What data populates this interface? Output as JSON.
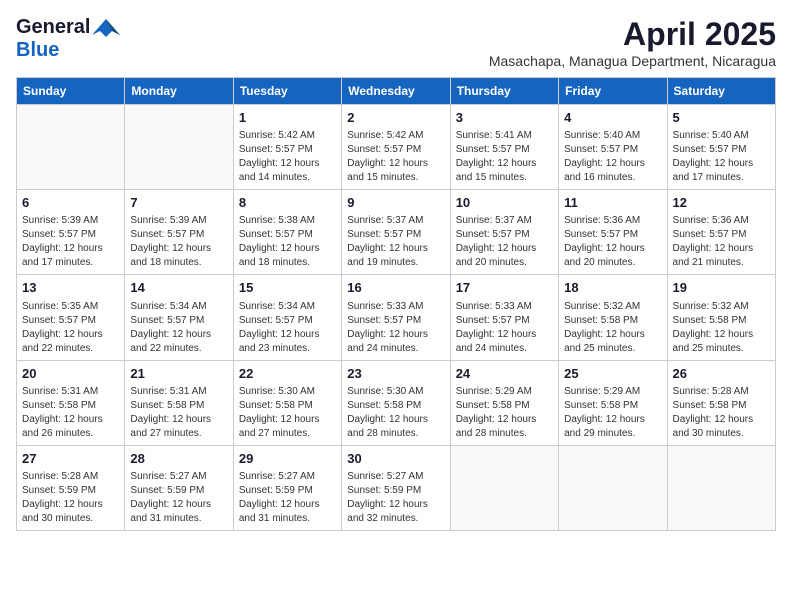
{
  "logo": {
    "general": "General",
    "blue": "Blue"
  },
  "title": "April 2025",
  "location": "Masachapa, Managua Department, Nicaragua",
  "days_header": [
    "Sunday",
    "Monday",
    "Tuesday",
    "Wednesday",
    "Thursday",
    "Friday",
    "Saturday"
  ],
  "weeks": [
    [
      {
        "day": "",
        "info": ""
      },
      {
        "day": "",
        "info": ""
      },
      {
        "day": "1",
        "info": "Sunrise: 5:42 AM\nSunset: 5:57 PM\nDaylight: 12 hours\nand 14 minutes."
      },
      {
        "day": "2",
        "info": "Sunrise: 5:42 AM\nSunset: 5:57 PM\nDaylight: 12 hours\nand 15 minutes."
      },
      {
        "day": "3",
        "info": "Sunrise: 5:41 AM\nSunset: 5:57 PM\nDaylight: 12 hours\nand 15 minutes."
      },
      {
        "day": "4",
        "info": "Sunrise: 5:40 AM\nSunset: 5:57 PM\nDaylight: 12 hours\nand 16 minutes."
      },
      {
        "day": "5",
        "info": "Sunrise: 5:40 AM\nSunset: 5:57 PM\nDaylight: 12 hours\nand 17 minutes."
      }
    ],
    [
      {
        "day": "6",
        "info": "Sunrise: 5:39 AM\nSunset: 5:57 PM\nDaylight: 12 hours\nand 17 minutes."
      },
      {
        "day": "7",
        "info": "Sunrise: 5:39 AM\nSunset: 5:57 PM\nDaylight: 12 hours\nand 18 minutes."
      },
      {
        "day": "8",
        "info": "Sunrise: 5:38 AM\nSunset: 5:57 PM\nDaylight: 12 hours\nand 18 minutes."
      },
      {
        "day": "9",
        "info": "Sunrise: 5:37 AM\nSunset: 5:57 PM\nDaylight: 12 hours\nand 19 minutes."
      },
      {
        "day": "10",
        "info": "Sunrise: 5:37 AM\nSunset: 5:57 PM\nDaylight: 12 hours\nand 20 minutes."
      },
      {
        "day": "11",
        "info": "Sunrise: 5:36 AM\nSunset: 5:57 PM\nDaylight: 12 hours\nand 20 minutes."
      },
      {
        "day": "12",
        "info": "Sunrise: 5:36 AM\nSunset: 5:57 PM\nDaylight: 12 hours\nand 21 minutes."
      }
    ],
    [
      {
        "day": "13",
        "info": "Sunrise: 5:35 AM\nSunset: 5:57 PM\nDaylight: 12 hours\nand 22 minutes."
      },
      {
        "day": "14",
        "info": "Sunrise: 5:34 AM\nSunset: 5:57 PM\nDaylight: 12 hours\nand 22 minutes."
      },
      {
        "day": "15",
        "info": "Sunrise: 5:34 AM\nSunset: 5:57 PM\nDaylight: 12 hours\nand 23 minutes."
      },
      {
        "day": "16",
        "info": "Sunrise: 5:33 AM\nSunset: 5:57 PM\nDaylight: 12 hours\nand 24 minutes."
      },
      {
        "day": "17",
        "info": "Sunrise: 5:33 AM\nSunset: 5:57 PM\nDaylight: 12 hours\nand 24 minutes."
      },
      {
        "day": "18",
        "info": "Sunrise: 5:32 AM\nSunset: 5:58 PM\nDaylight: 12 hours\nand 25 minutes."
      },
      {
        "day": "19",
        "info": "Sunrise: 5:32 AM\nSunset: 5:58 PM\nDaylight: 12 hours\nand 25 minutes."
      }
    ],
    [
      {
        "day": "20",
        "info": "Sunrise: 5:31 AM\nSunset: 5:58 PM\nDaylight: 12 hours\nand 26 minutes."
      },
      {
        "day": "21",
        "info": "Sunrise: 5:31 AM\nSunset: 5:58 PM\nDaylight: 12 hours\nand 27 minutes."
      },
      {
        "day": "22",
        "info": "Sunrise: 5:30 AM\nSunset: 5:58 PM\nDaylight: 12 hours\nand 27 minutes."
      },
      {
        "day": "23",
        "info": "Sunrise: 5:30 AM\nSunset: 5:58 PM\nDaylight: 12 hours\nand 28 minutes."
      },
      {
        "day": "24",
        "info": "Sunrise: 5:29 AM\nSunset: 5:58 PM\nDaylight: 12 hours\nand 28 minutes."
      },
      {
        "day": "25",
        "info": "Sunrise: 5:29 AM\nSunset: 5:58 PM\nDaylight: 12 hours\nand 29 minutes."
      },
      {
        "day": "26",
        "info": "Sunrise: 5:28 AM\nSunset: 5:58 PM\nDaylight: 12 hours\nand 30 minutes."
      }
    ],
    [
      {
        "day": "27",
        "info": "Sunrise: 5:28 AM\nSunset: 5:59 PM\nDaylight: 12 hours\nand 30 minutes."
      },
      {
        "day": "28",
        "info": "Sunrise: 5:27 AM\nSunset: 5:59 PM\nDaylight: 12 hours\nand 31 minutes."
      },
      {
        "day": "29",
        "info": "Sunrise: 5:27 AM\nSunset: 5:59 PM\nDaylight: 12 hours\nand 31 minutes."
      },
      {
        "day": "30",
        "info": "Sunrise: 5:27 AM\nSunset: 5:59 PM\nDaylight: 12 hours\nand 32 minutes."
      },
      {
        "day": "",
        "info": ""
      },
      {
        "day": "",
        "info": ""
      },
      {
        "day": "",
        "info": ""
      }
    ]
  ]
}
